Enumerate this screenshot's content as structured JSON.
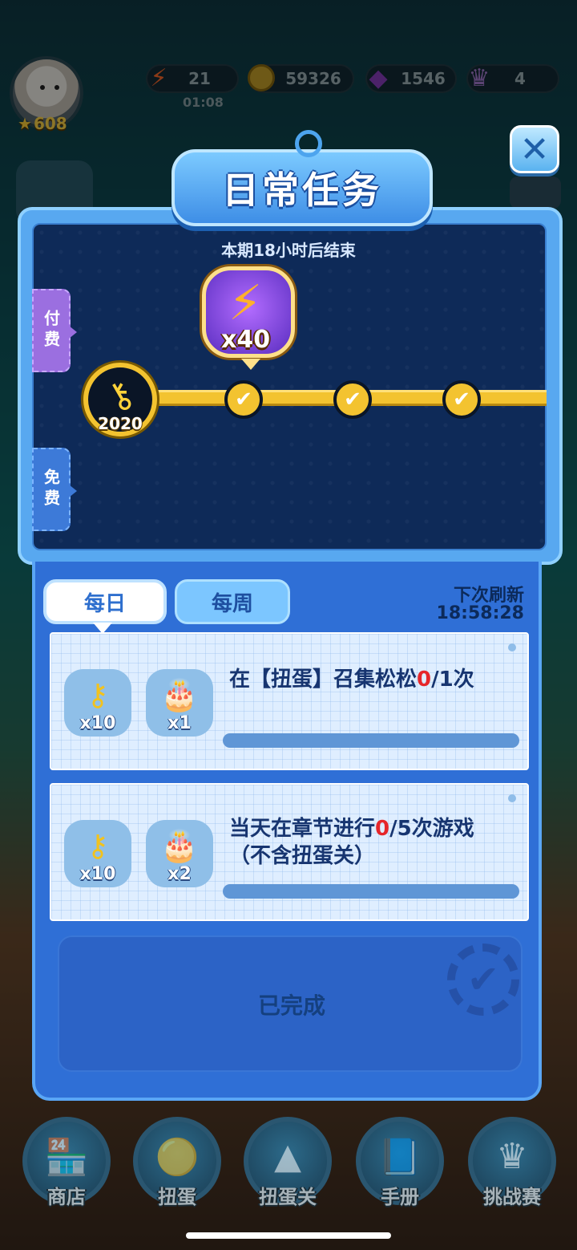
{
  "hud": {
    "player_level": "608",
    "energy": "21",
    "energy_timer": "01:08",
    "coins": "59326",
    "gems": "1546",
    "crowns": "4"
  },
  "modal": {
    "title": "日常任务",
    "period": "本期18小时后结束",
    "tab_paid": "付费",
    "tab_free": "免费",
    "key_points": "2020",
    "reward_count": "x40"
  },
  "tasks": {
    "tab_daily": "每日",
    "tab_weekly": "每周",
    "refresh_label": "下次刷新",
    "refresh_time": "18:58:28",
    "items": [
      {
        "text_prefix": "在【扭蛋】召集松松",
        "current": "0",
        "suffix": "/1次",
        "reward1_qty": "x10",
        "reward2_qty": "x1"
      },
      {
        "text_prefix": "当天在章节进行",
        "current": "0",
        "suffix": "/5次游戏",
        "line2": "（不含扭蛋关）",
        "reward1_qty": "x10",
        "reward2_qty": "x2"
      }
    ],
    "completed_label": "已完成"
  },
  "nav": {
    "shop": "商店",
    "gacha": "扭蛋",
    "gacha_level": "扭蛋关",
    "handbook": "手册",
    "challenge": "挑战赛"
  },
  "icons": {
    "energy": "lightning-icon",
    "coin": "coin-icon",
    "gem": "gem-icon",
    "crown": "crown-icon",
    "key": "key-icon",
    "cake": "cake-icon",
    "check": "check-icon",
    "close": "close-icon"
  },
  "colors": {
    "panel_blue": "#2f6fd6",
    "track_gold": "#f3c330",
    "progress_red": "#e6262a",
    "reward_purple": "#7a3fe0"
  }
}
